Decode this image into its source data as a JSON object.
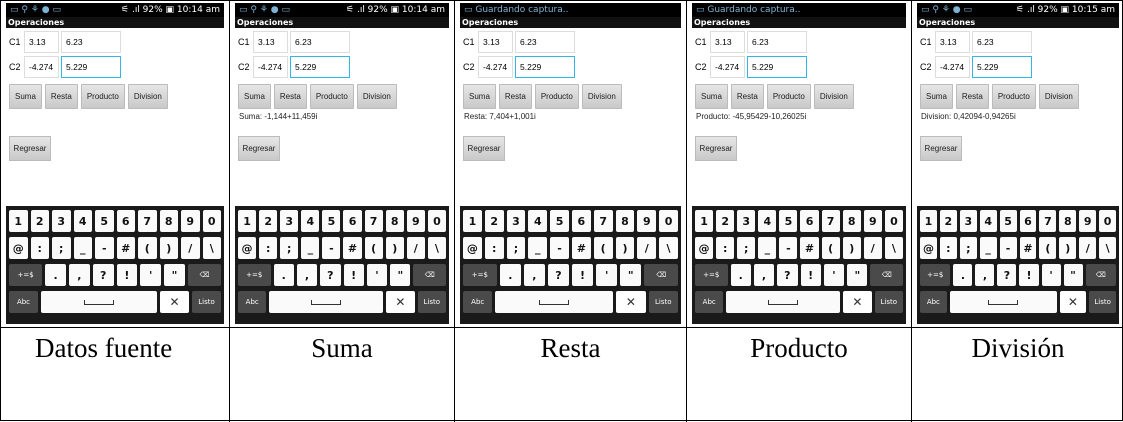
{
  "screens": [
    {
      "status_left": "▭ ⚲ ⚘ ● ▭",
      "status_right": "⚟ .ıl 92% ▣ 10:14 am",
      "title": "Operaciones",
      "c1_label": "C1",
      "c1_a": "3.13",
      "c1_b": "6.23",
      "c2_label": "C2",
      "c2_a": "-4.274",
      "c2_b": "5.229",
      "result": ""
    },
    {
      "status_left": "▭ ⚲ ⚘ ● ▭",
      "status_right": "⚟ .ıl 92% ▣ 10:14 am",
      "title": "Operaciones",
      "c1_label": "C1",
      "c1_a": "3.13",
      "c1_b": "6.23",
      "c2_label": "C2",
      "c2_a": "-4.274",
      "c2_b": "5.229",
      "result": "Suma: -1,144+11,459i"
    },
    {
      "status_left": "▭ Guardando captura..",
      "status_right": "",
      "title": "Operaciones",
      "c1_label": "C1",
      "c1_a": "3.13",
      "c1_b": "6.23",
      "c2_label": "C2",
      "c2_a": "-4.274",
      "c2_b": "5.229",
      "result": "Resta: 7,404+1,001i"
    },
    {
      "status_left": "▭ Guardando captura..",
      "status_right": "",
      "title": "Operaciones",
      "c1_label": "C1",
      "c1_a": "3.13",
      "c1_b": "6.23",
      "c2_label": "C2",
      "c2_a": "-4.274",
      "c2_b": "5.229",
      "result": "Producto: -45,95429-10,26025i"
    },
    {
      "status_left": "▭ ⚲ ⚘ ● ▭",
      "status_right": "⚟ .ıl 92% ▣ 10:15 am",
      "title": "Operaciones",
      "c1_label": "C1",
      "c1_a": "3.13",
      "c1_b": "6.23",
      "c2_label": "C2",
      "c2_a": "-4.274",
      "c2_b": "5.229",
      "result": "Division: 0,42094-0,94265i"
    }
  ],
  "buttons": {
    "suma": "Suma",
    "resta": "Resta",
    "producto": "Producto",
    "division": "Division",
    "regresar": "Regresar"
  },
  "keyboard": {
    "row1": [
      "1",
      "2",
      "3",
      "4",
      "5",
      "6",
      "7",
      "8",
      "9",
      "0"
    ],
    "row2": [
      "@",
      ":",
      ";",
      "_",
      "-",
      "#",
      "(",
      ")",
      "/",
      "\\"
    ],
    "row3": [
      "+=$",
      ".",
      ",",
      "?",
      "!",
      "'",
      "\"",
      "⌫"
    ],
    "row4": [
      "Abc",
      "␣",
      "✕",
      "Listo"
    ]
  },
  "captions": [
    "Datos fuente",
    "Suma",
    "Resta",
    "Producto",
    "División"
  ],
  "colors": {
    "focus_border": "#33b5e5",
    "keyboard_bg": "#1a1a1a"
  }
}
